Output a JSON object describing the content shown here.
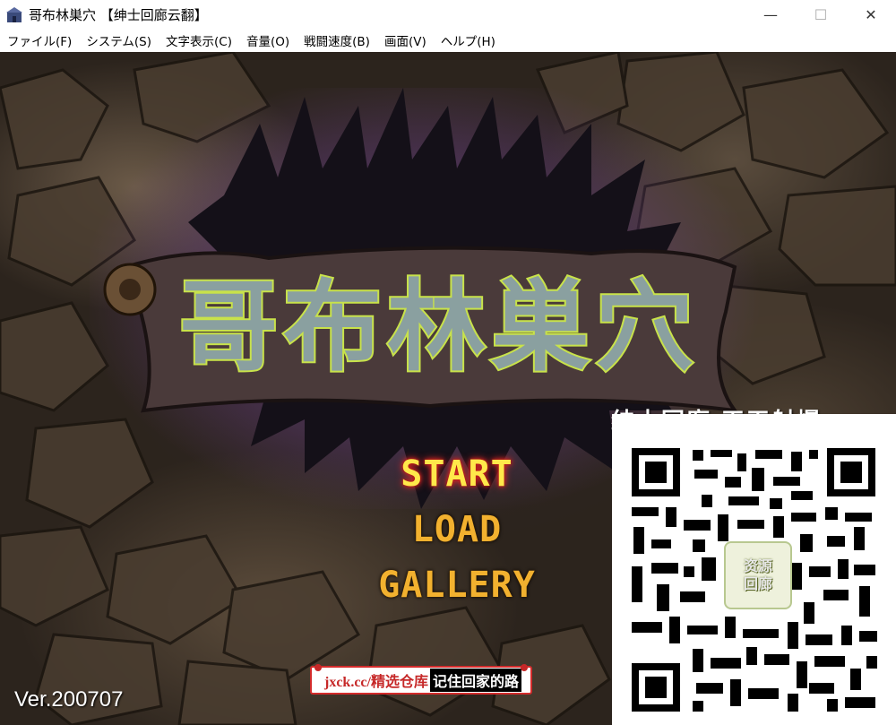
{
  "window": {
    "title": "哥布林巣穴 【绅士回廊云翻】",
    "controls": {
      "minimize": "—",
      "maximize": "☐",
      "close": "✕"
    }
  },
  "menu": [
    {
      "label": "ファイル(F)"
    },
    {
      "label": "システム(S)"
    },
    {
      "label": "文字表示(C)"
    },
    {
      "label": "音量(O)"
    },
    {
      "label": "戦闘速度(B)"
    },
    {
      "label": "画面(V)"
    },
    {
      "label": "ヘルプ(H)"
    }
  ],
  "game": {
    "logo_title": "哥布林巣穴",
    "options": {
      "start": "START",
      "load": "LOAD",
      "gallery": "GALLERY"
    },
    "version": "Ver.200707",
    "watermark": "绅士回廊 天天射爆",
    "banner": {
      "url": "jxck.cc/精选仓库",
      "slogan": "记住回家的路"
    },
    "qr_badge": [
      "资源",
      "回廊"
    ]
  },
  "colors": {
    "start_text": "#ffe84a",
    "option_text": "#f2b12f",
    "banner_border": "#d32b2b"
  },
  "icons": {
    "app": "castle-app-icon",
    "minimize": "minimize-icon",
    "maximize": "maximize-icon",
    "close": "close-icon"
  }
}
